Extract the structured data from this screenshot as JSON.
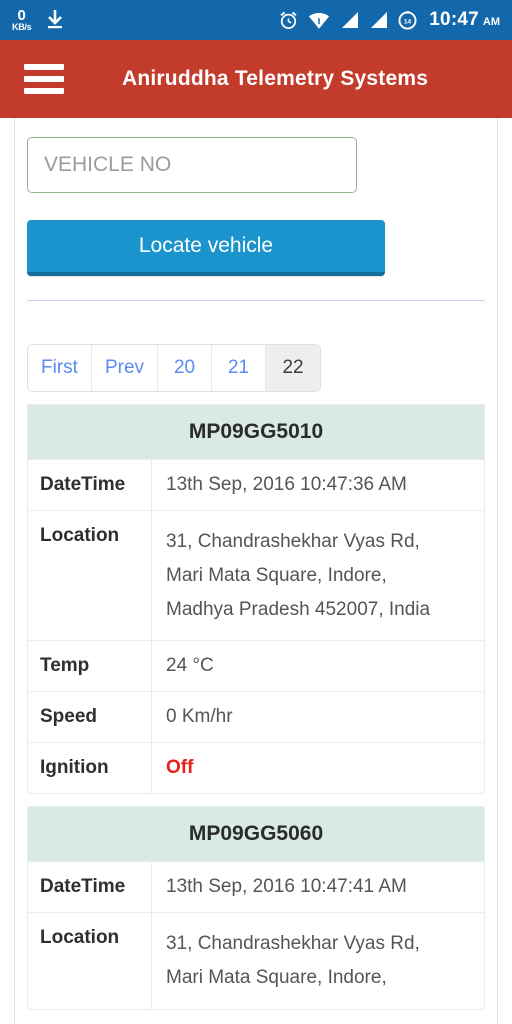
{
  "statusbar": {
    "network_speed_value": "0",
    "network_speed_unit": "KB/s",
    "download_icon": "download-icon",
    "alarm_icon": "alarm-clock-icon",
    "wifi_icon": "wifi-icon",
    "signal_icon_1": "signal-bars-icon",
    "signal_icon_2": "signal-bars-icon",
    "battery_icon": "battery-circle-icon",
    "time": "10:47",
    "meridiem": "AM",
    "bg_color": "#1268ab"
  },
  "appbar": {
    "menu_icon": "hamburger-menu-icon",
    "title": "Aniruddha Telemetry Systems",
    "bg_color": "#c23b2b"
  },
  "form": {
    "vehicle_no_placeholder": "VEHICLE NO",
    "vehicle_no_value": "",
    "locate_button_label": "Locate vehicle",
    "button_color": "#1b93cd",
    "input_border_color": "#8fb98f"
  },
  "pagination": {
    "items": [
      {
        "label": "First",
        "active": false
      },
      {
        "label": "Prev",
        "active": false
      },
      {
        "label": "20",
        "active": false
      },
      {
        "label": "21",
        "active": false
      },
      {
        "label": "22",
        "active": true
      }
    ],
    "link_color": "#5b8bf0",
    "active_bg": "#eeeeee"
  },
  "vehicles": [
    {
      "vehicle_no": "MP09GG5010",
      "rows": [
        {
          "label": "DateTime",
          "value": "13th Sep, 2016 10:47:36 AM"
        },
        {
          "label": "Location",
          "value_lines": [
            "31, Chandrashekhar Vyas Rd,",
            "Mari Mata Square, Indore,",
            "Madhya Pradesh 452007, India"
          ]
        },
        {
          "label": "Temp",
          "value": "24  °C"
        },
        {
          "label": "Speed",
          "value": "0 Km/hr"
        },
        {
          "label": "Ignition",
          "value": "Off",
          "status": "off",
          "color": "#e8201a"
        }
      ]
    },
    {
      "vehicle_no": "MP09GG5060",
      "rows": [
        {
          "label": "DateTime",
          "value": "13th Sep, 2016 10:47:41 AM"
        },
        {
          "label": "Location",
          "value_lines": [
            "31, Chandrashekhar Vyas Rd,",
            "Mari Mata Square, Indore,"
          ]
        }
      ]
    }
  ],
  "header_bg_color": "#d9e9e3"
}
